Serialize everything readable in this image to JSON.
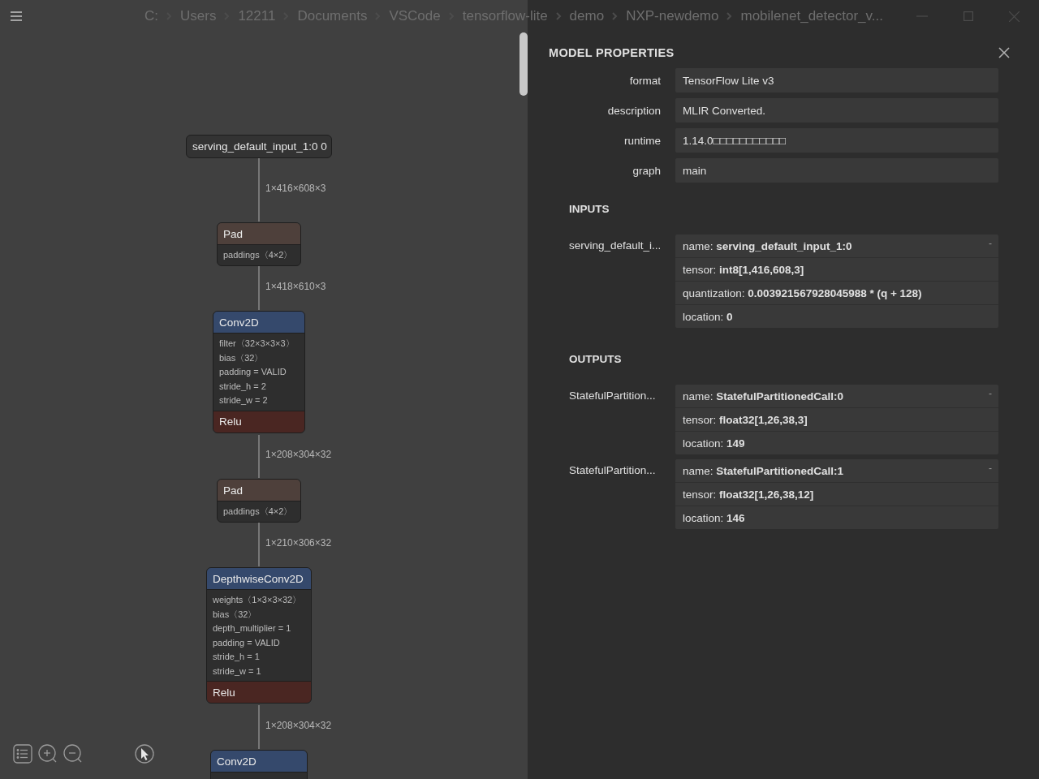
{
  "titlebar": {
    "breadcrumbs": [
      "C:",
      "Users",
      "12211",
      "Documents",
      "VSCode",
      "tensorflow-lite",
      "demo",
      "NXP-newdemo",
      "mobilenet_detector_v..."
    ]
  },
  "graph": {
    "nodes": [
      {
        "kind": "input",
        "title": "serving_default_input_1:0 0",
        "edge": "1×416×608×3"
      },
      {
        "kind": "op",
        "color": "#4e403b",
        "title": "Pad",
        "attributes": [
          "paddings〈4×2〉"
        ],
        "edge": "1×418×610×3"
      },
      {
        "kind": "op",
        "color": "#35496c",
        "title": "Conv2D",
        "attributes": [
          "filter〈32×3×3×3〉",
          "bias〈32〉",
          "padding = VALID",
          "stride_h = 2",
          "stride_w = 2"
        ],
        "activation": "Relu",
        "edge": "1×208×304×32"
      },
      {
        "kind": "op",
        "color": "#4e403b",
        "title": "Pad",
        "attributes": [
          "paddings〈4×2〉"
        ],
        "edge": "1×210×306×32"
      },
      {
        "kind": "op",
        "color": "#35496c",
        "title": "DepthwiseConv2D",
        "attributes": [
          "weights〈1×3×3×32〉",
          "bias〈32〉",
          "depth_multiplier = 1",
          "padding = VALID",
          "stride_h = 1",
          "stride_w = 1"
        ],
        "activation": "Relu",
        "edge": "1×208×304×32"
      },
      {
        "kind": "op",
        "color": "#35496c",
        "title": "Conv2D"
      }
    ]
  },
  "sidebar": {
    "title": "MODEL PROPERTIES",
    "properties": [
      {
        "label": "format",
        "value": "TensorFlow Lite v3"
      },
      {
        "label": "description",
        "value": "MLIR Converted."
      },
      {
        "label": "runtime",
        "value": "1.14.0□□□□□□□□□□□"
      },
      {
        "label": "graph",
        "value": "main"
      }
    ],
    "sections": [
      {
        "title": "INPUTS",
        "arguments": [
          {
            "label": "serving_default_i...",
            "toggle": "-",
            "lines": [
              "name: **serving_default_input_1:0**",
              "tensor: **int8[1,416,608,3]**",
              "quantization: **0.003921567928045988 * (q + 128)**",
              "location: **0**"
            ]
          }
        ]
      },
      {
        "title": "OUTPUTS",
        "arguments": [
          {
            "label": "StatefulPartition...",
            "toggle": "-",
            "lines": [
              "name: **StatefulPartitionedCall:0**",
              "tensor: **float32[1,26,38,3]**",
              "location: **149**"
            ]
          },
          {
            "label": "StatefulPartition...",
            "toggle": "-",
            "lines": [
              "name: **StatefulPartitionedCall:1**",
              "tensor: **float32[1,26,38,12]**",
              "location: **146**"
            ]
          }
        ]
      }
    ]
  }
}
